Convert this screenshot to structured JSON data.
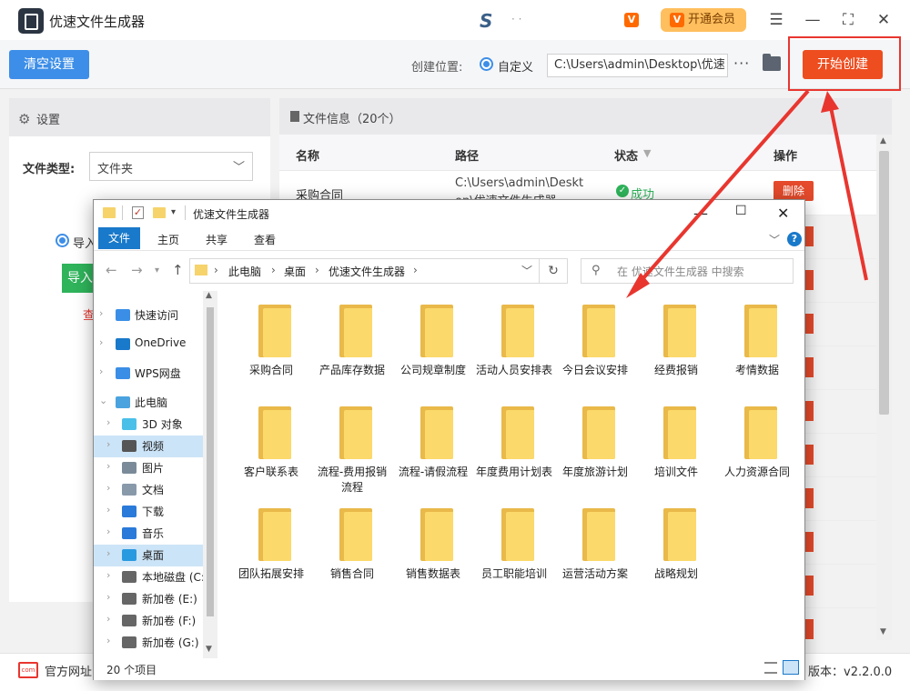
{
  "app": {
    "title": "优速文件生成器",
    "vip_label": "开通会员",
    "vip_icon": "vip-badge-icon",
    "window_controls": {
      "menu": "☰",
      "minimize": "—",
      "maximize": "⛶",
      "close": "✕"
    }
  },
  "toolbar": {
    "clear_label": "清空设置",
    "location_label": "创建位置:",
    "custom_label": "自定义",
    "path_value": "C:\\Users\\admin\\Desktop\\优速",
    "more_label": "···",
    "start_label": "开始创建"
  },
  "settings": {
    "title": "设置",
    "filetype_label": "文件类型:",
    "filetype_value": "文件夹",
    "import_radio_label": "导入",
    "import_button_label": "导入",
    "view_link": "查"
  },
  "file_info": {
    "title": "文件信息（20个）",
    "columns": {
      "name": "名称",
      "path": "路径",
      "status": "状态",
      "action": "操作"
    },
    "row1": {
      "name": "采购合同",
      "path": "C:\\Users\\admin\\Deskt op\\优速文件生成器",
      "status": "成功"
    },
    "delete_label": "删除"
  },
  "footer": {
    "website_label": "官方网址",
    "website_icon_text": "com",
    "version_label": "版本：v2.2.0.0"
  },
  "explorer": {
    "title": "优速文件生成器",
    "ribbon_tabs": [
      "文件",
      "主页",
      "共享",
      "查看"
    ],
    "breadcrumb": [
      "此电脑",
      "桌面",
      "优速文件生成器"
    ],
    "search_placeholder": "在 优速文件生成器 中搜索",
    "nav_items": [
      {
        "label": "快速访问",
        "icon": "star-icon",
        "color": "#3a8ee6"
      },
      {
        "label": "OneDrive",
        "icon": "cloud-icon",
        "color": "#1979ca"
      },
      {
        "label": "WPS网盘",
        "icon": "cloud-icon",
        "color": "#3a8ee6"
      },
      {
        "label": "此电脑",
        "icon": "computer-icon",
        "color": "#4aa3df"
      },
      {
        "label": "3D 对象",
        "icon": "cube-icon",
        "color": "#4ac0e8"
      },
      {
        "label": "视频",
        "icon": "film-icon",
        "color": "#555555"
      },
      {
        "label": "图片",
        "icon": "picture-icon",
        "color": "#7a8a99"
      },
      {
        "label": "文档",
        "icon": "document-icon",
        "color": "#8899aa"
      },
      {
        "label": "下载",
        "icon": "download-icon",
        "color": "#2a7ad9"
      },
      {
        "label": "音乐",
        "icon": "music-icon",
        "color": "#2a7ad9"
      },
      {
        "label": "桌面",
        "icon": "desktop-icon",
        "color": "#2a9ae0"
      },
      {
        "label": "本地磁盘 (C:",
        "icon": "drive-icon",
        "color": "#666666"
      },
      {
        "label": "新加卷 (E:)",
        "icon": "drive-icon",
        "color": "#666666"
      },
      {
        "label": "新加卷 (F:)",
        "icon": "drive-icon",
        "color": "#666666"
      },
      {
        "label": "新加卷 (G:)",
        "icon": "drive-icon",
        "color": "#666666"
      }
    ],
    "folders": [
      "采购合同",
      "产品库存数据",
      "公司规章制度",
      "活动人员安排表",
      "今日会议安排",
      "经费报销",
      "考情数据",
      "客户联系表",
      "流程-费用报销流程",
      "流程-请假流程",
      "年度费用计划表",
      "年度旅游计划",
      "培训文件",
      "人力资源合同",
      "团队拓展安排",
      "销售合同",
      "销售数据表",
      "员工职能培训",
      "运营活动方案",
      "战略规划"
    ],
    "status_count": "20 个项目"
  },
  "colors": {
    "primary": "#3d8ee8",
    "start": "#ee4d1f",
    "success": "#2fb35b",
    "danger": "#e44a2b",
    "highlight": "#e8362f",
    "folder": "#fbd96b"
  }
}
